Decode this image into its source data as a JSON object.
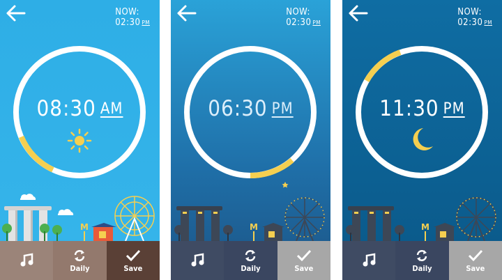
{
  "screens": [
    {
      "now_label": "NOW:",
      "now_time": "02:30",
      "now_ampm": "PM",
      "alarm_hour": "08",
      "alarm_colon": ":",
      "alarm_minute": "30",
      "alarm_ampm": "AM",
      "weather_icon": "sun-icon",
      "toolbar": {
        "music_icon": "music-note-icon",
        "daily_label": "Daily",
        "save_label": "Save"
      }
    },
    {
      "now_label": "NOW:",
      "now_time": "02:30",
      "now_ampm": "PM",
      "alarm_hour": "06",
      "alarm_colon": ":",
      "alarm_minute": "30",
      "alarm_ampm": "PM",
      "weather_icon": "none",
      "toolbar": {
        "music_icon": "music-note-icon",
        "daily_label": "Daily",
        "save_label": "Save"
      }
    },
    {
      "now_label": "NOW:",
      "now_time": "02:30",
      "now_ampm": "PM",
      "alarm_hour": "11",
      "alarm_colon": ":",
      "alarm_minute": "30",
      "alarm_ampm": "PM",
      "weather_icon": "moon-icon",
      "toolbar": {
        "music_icon": "music-note-icon",
        "daily_label": "Daily",
        "save_label": "Save"
      }
    }
  ],
  "colors": {
    "ring": "#ffffff",
    "ring_highlight": "#f5cf50",
    "accent_yellow": "#f5cf50"
  }
}
